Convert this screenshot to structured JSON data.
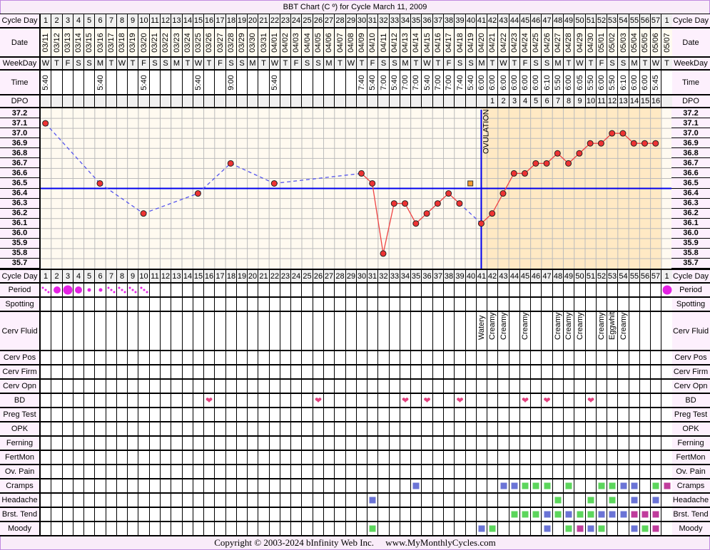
{
  "title": "BBT Chart (C º) for Cycle March 11, 2009",
  "labels": {
    "cycle_day": "Cycle Day",
    "date": "Date",
    "weekday": "WeekDay",
    "time": "Time",
    "dpo": "DPO"
  },
  "days": [
    "1",
    "2",
    "3",
    "4",
    "5",
    "6",
    "7",
    "8",
    "9",
    "10",
    "11",
    "12",
    "13",
    "14",
    "15",
    "16",
    "17",
    "18",
    "19",
    "20",
    "21",
    "22",
    "23",
    "24",
    "25",
    "26",
    "27",
    "28",
    "29",
    "30",
    "31",
    "32",
    "33",
    "34",
    "35",
    "36",
    "37",
    "38",
    "39",
    "40",
    "41",
    "42",
    "43",
    "44",
    "45",
    "46",
    "47",
    "48",
    "49",
    "50",
    "51",
    "52",
    "53",
    "54",
    "55",
    "56",
    "57",
    "1"
  ],
  "dates": [
    "03/11",
    "03/12",
    "03/13",
    "03/14",
    "03/15",
    "03/16",
    "03/17",
    "03/18",
    "03/19",
    "03/20",
    "03/21",
    "03/22",
    "03/23",
    "03/24",
    "03/25",
    "03/26",
    "03/27",
    "03/28",
    "03/29",
    "03/30",
    "03/31",
    "04/01",
    "04/02",
    "04/03",
    "04/04",
    "04/05",
    "04/06",
    "04/07",
    "04/08",
    "04/09",
    "04/10",
    "04/11",
    "04/12",
    "04/13",
    "04/14",
    "04/15",
    "04/16",
    "04/17",
    "04/18",
    "04/19",
    "04/20",
    "04/21",
    "04/22",
    "04/23",
    "04/24",
    "04/25",
    "04/26",
    "04/27",
    "04/28",
    "04/29",
    "04/30",
    "05/01",
    "05/02",
    "05/03",
    "05/04",
    "05/05",
    "05/06",
    "05/07"
  ],
  "weekdays": [
    "W",
    "T",
    "F",
    "S",
    "S",
    "M",
    "T",
    "W",
    "T",
    "F",
    "S",
    "S",
    "M",
    "T",
    "W",
    "T",
    "F",
    "S",
    "S",
    "M",
    "T",
    "W",
    "T",
    "F",
    "S",
    "S",
    "M",
    "T",
    "W",
    "T",
    "F",
    "S",
    "S",
    "M",
    "T",
    "W",
    "T",
    "F",
    "S",
    "S",
    "M",
    "T",
    "W",
    "T",
    "F",
    "S",
    "S",
    "M",
    "T",
    "W",
    "T",
    "F",
    "S",
    "S",
    "M",
    "T",
    "W",
    "T"
  ],
  "times": [
    "5:40",
    "",
    "",
    "",
    "",
    "5:40",
    "",
    "",
    "",
    "5:40",
    "",
    "",
    "",
    "",
    "5:40",
    "",
    "",
    "9:00",
    "",
    "",
    "",
    "5:40",
    "",
    "",
    "",
    "",
    "",
    "",
    "",
    "7:40",
    "5:40",
    "7:00",
    "5:40",
    "7:00",
    "7:00",
    "5:40",
    "7:00",
    "7:00",
    "7:40",
    "5:40",
    "6:00",
    "6:00",
    "6:00",
    "6:00",
    "6:00",
    "6:00",
    "6:10",
    "5:50",
    "6:00",
    "6:05",
    "5:50",
    "6:00",
    "5:50",
    "6:10",
    "6:00",
    "6:00",
    "5:45",
    ""
  ],
  "dpo": [
    "",
    "",
    "",
    "",
    "",
    "",
    "",
    "",
    "",
    "",
    "",
    "",
    "",
    "",
    "",
    "",
    "",
    "",
    "",
    "",
    "",
    "",
    "",
    "",
    "",
    "",
    "",
    "",
    "",
    "",
    "",
    "",
    "",
    "",
    "",
    "",
    "",
    "",
    "",
    "",
    "",
    "1",
    "2",
    "3",
    "4",
    "5",
    "6",
    "7",
    "8",
    "9",
    "10",
    "11",
    "12",
    "13",
    "14",
    "15",
    "16",
    ""
  ],
  "chart_data": {
    "type": "line",
    "ylabel": "",
    "ylim": [
      35.7,
      37.2
    ],
    "yticks": [
      "37.2",
      "37.1",
      "37.0",
      "36.9",
      "36.8",
      "36.7",
      "36.6",
      "36.5",
      "36.4",
      "36.3",
      "36.2",
      "36.1",
      "36.0",
      "35.9",
      "35.8",
      "35.7"
    ],
    "points": [
      {
        "day": 1,
        "temp": 37.1
      },
      {
        "day": 6,
        "temp": 36.5
      },
      {
        "day": 10,
        "temp": 36.2
      },
      {
        "day": 15,
        "temp": 36.4
      },
      {
        "day": 18,
        "temp": 36.7
      },
      {
        "day": 22,
        "temp": 36.5
      },
      {
        "day": 30,
        "temp": 36.6
      },
      {
        "day": 31,
        "temp": 36.5
      },
      {
        "day": 32,
        "temp": 35.8
      },
      {
        "day": 33,
        "temp": 36.3
      },
      {
        "day": 34,
        "temp": 36.3
      },
      {
        "day": 35,
        "temp": 36.1
      },
      {
        "day": 36,
        "temp": 36.2
      },
      {
        "day": 37,
        "temp": 36.3
      },
      {
        "day": 38,
        "temp": 36.4
      },
      {
        "day": 39,
        "temp": 36.3
      },
      {
        "day": 41,
        "temp": 36.1
      },
      {
        "day": 42,
        "temp": 36.2
      },
      {
        "day": 43,
        "temp": 36.4
      },
      {
        "day": 44,
        "temp": 36.6
      },
      {
        "day": 45,
        "temp": 36.6
      },
      {
        "day": 46,
        "temp": 36.7
      },
      {
        "day": 47,
        "temp": 36.7
      },
      {
        "day": 48,
        "temp": 36.8
      },
      {
        "day": 49,
        "temp": 36.7
      },
      {
        "day": 50,
        "temp": 36.8
      },
      {
        "day": 51,
        "temp": 36.9
      },
      {
        "day": 52,
        "temp": 36.9
      },
      {
        "day": 53,
        "temp": 37.0
      },
      {
        "day": 54,
        "temp": 37.0
      },
      {
        "day": 55,
        "temp": 36.9
      },
      {
        "day": 56,
        "temp": 36.9
      },
      {
        "day": 57,
        "temp": 36.9
      }
    ],
    "discarded": [
      {
        "day": 40,
        "temp": 36.5
      }
    ],
    "coverline": 36.45,
    "ovulation_day": 41,
    "ovulation_label": "OVULATION",
    "grid": true,
    "colors": {
      "point": "#ee3333",
      "solid_line": "#ee4444",
      "dashed_line": "#5555ee",
      "coverline": "#0000ee",
      "discarded": "#f59a30",
      "pre_ovulation_bg": "#fffaf0",
      "post_ovulation_bg": "#ffe9c4"
    }
  },
  "mark_colors": {
    "green": "#5cd65c",
    "blue": "#6b74d6",
    "magenta": "#c03c9c",
    "period": "#e422e4",
    "heart": "#e2407e"
  },
  "symptom_rows": [
    {
      "label": "Period",
      "kind": "period",
      "entries": [
        {
          "day": 1,
          "flow": "spotting"
        },
        {
          "day": 2,
          "flow": "medium"
        },
        {
          "day": 3,
          "flow": "heavy"
        },
        {
          "day": 4,
          "flow": "medium"
        },
        {
          "day": 5,
          "flow": "light"
        },
        {
          "day": 6,
          "flow": "light"
        },
        {
          "day": 7,
          "flow": "spotting"
        },
        {
          "day": 8,
          "flow": "spotting"
        },
        {
          "day": 9,
          "flow": "spotting"
        },
        {
          "day": 10,
          "flow": "spotting"
        },
        {
          "day": 58,
          "flow": "heavy"
        }
      ]
    },
    {
      "label": "Spotting",
      "kind": "none",
      "entries": []
    },
    {
      "label": "Cerv Fluid",
      "kind": "text",
      "entries": [
        {
          "day": 41,
          "value": "Watery"
        },
        {
          "day": 42,
          "value": "Creamy"
        },
        {
          "day": 43,
          "value": "Creamy"
        },
        {
          "day": 45,
          "value": "Creamy"
        },
        {
          "day": 48,
          "value": "Creamy"
        },
        {
          "day": 49,
          "value": "Creamy"
        },
        {
          "day": 50,
          "value": "Creamy"
        },
        {
          "day": 52,
          "value": "Creamy"
        },
        {
          "day": 53,
          "value": "Eggwhite"
        },
        {
          "day": 54,
          "value": "Creamy"
        }
      ]
    },
    {
      "label": "Cerv Pos",
      "kind": "none",
      "entries": []
    },
    {
      "label": "Cerv Firm",
      "kind": "none",
      "entries": []
    },
    {
      "label": "Cerv Opn",
      "kind": "none",
      "entries": []
    },
    {
      "label": "BD",
      "kind": "heart",
      "entries": [
        {
          "day": 16
        },
        {
          "day": 26
        },
        {
          "day": 34
        },
        {
          "day": 36
        },
        {
          "day": 39
        },
        {
          "day": 45
        },
        {
          "day": 47
        },
        {
          "day": 51
        }
      ]
    },
    {
      "label": "Preg Test",
      "kind": "none",
      "entries": []
    },
    {
      "label": "OPK",
      "kind": "none",
      "entries": []
    },
    {
      "label": "Ferning",
      "kind": "none",
      "entries": []
    },
    {
      "label": "FertMon",
      "kind": "none",
      "entries": []
    },
    {
      "label": "Ov. Pain",
      "kind": "none",
      "entries": []
    },
    {
      "label": "Cramps",
      "kind": "square",
      "entries": [
        {
          "day": 35,
          "color": "blue"
        },
        {
          "day": 43,
          "color": "blue"
        },
        {
          "day": 44,
          "color": "blue"
        },
        {
          "day": 45,
          "color": "green"
        },
        {
          "day": 46,
          "color": "green"
        },
        {
          "day": 47,
          "color": "green"
        },
        {
          "day": 49,
          "color": "green"
        },
        {
          "day": 52,
          "color": "green"
        },
        {
          "day": 53,
          "color": "green"
        },
        {
          "day": 54,
          "color": "blue"
        },
        {
          "day": 55,
          "color": "blue"
        },
        {
          "day": 57,
          "color": "green"
        },
        {
          "day": 58,
          "color": "magenta"
        }
      ]
    },
    {
      "label": "Headache",
      "kind": "square",
      "entries": [
        {
          "day": 31,
          "color": "blue"
        },
        {
          "day": 48,
          "color": "green"
        },
        {
          "day": 51,
          "color": "green"
        },
        {
          "day": 53,
          "color": "green"
        },
        {
          "day": 55,
          "color": "blue"
        },
        {
          "day": 57,
          "color": "blue"
        }
      ]
    },
    {
      "label": "Brst. Tend",
      "kind": "square",
      "entries": [
        {
          "day": 44,
          "color": "green"
        },
        {
          "day": 45,
          "color": "green"
        },
        {
          "day": 46,
          "color": "green"
        },
        {
          "day": 47,
          "color": "blue"
        },
        {
          "day": 48,
          "color": "green"
        },
        {
          "day": 49,
          "color": "blue"
        },
        {
          "day": 50,
          "color": "green"
        },
        {
          "day": 51,
          "color": "green"
        },
        {
          "day": 52,
          "color": "blue"
        },
        {
          "day": 53,
          "color": "blue"
        },
        {
          "day": 54,
          "color": "blue"
        },
        {
          "day": 55,
          "color": "magenta"
        },
        {
          "day": 56,
          "color": "magenta"
        },
        {
          "day": 57,
          "color": "magenta"
        }
      ]
    },
    {
      "label": "Moody",
      "kind": "square",
      "entries": [
        {
          "day": 31,
          "color": "green"
        },
        {
          "day": 41,
          "color": "blue"
        },
        {
          "day": 42,
          "color": "green"
        },
        {
          "day": 47,
          "color": "blue"
        },
        {
          "day": 49,
          "color": "green"
        },
        {
          "day": 50,
          "color": "magenta"
        },
        {
          "day": 51,
          "color": "blue"
        },
        {
          "day": 52,
          "color": "green"
        },
        {
          "day": 55,
          "color": "blue"
        },
        {
          "day": 56,
          "color": "green"
        },
        {
          "day": 57,
          "color": "magenta"
        }
      ]
    }
  ],
  "copyright": "Copyright © 2003-2024 bInfinity Web Inc.     www.MyMonthlyCycles.com"
}
